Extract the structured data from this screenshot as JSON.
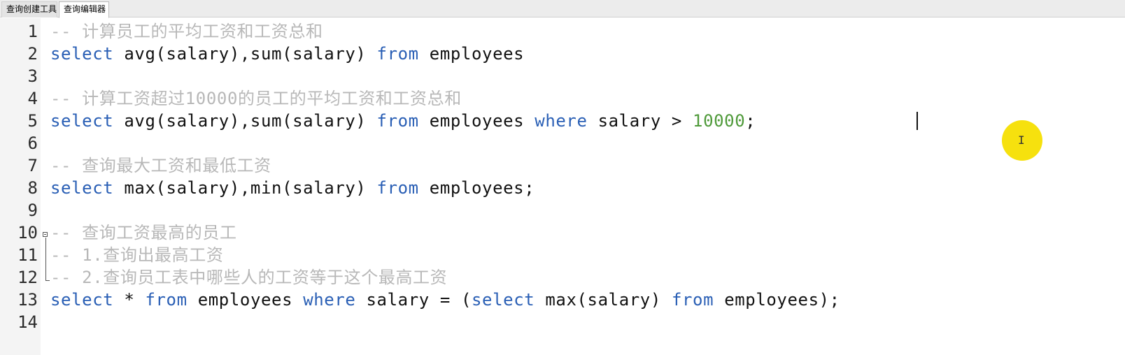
{
  "tabs": [
    {
      "label": "查询创建工具"
    },
    {
      "label": "查询编辑器"
    }
  ],
  "editor": {
    "lines": [
      {
        "num": "1",
        "segments": [
          {
            "type": "comment",
            "text": "-- 计算员工的平均工资和工资总和"
          }
        ]
      },
      {
        "num": "2",
        "segments": [
          {
            "type": "kw",
            "text": "select"
          },
          {
            "type": "plain",
            "text": " avg(salary),sum(salary) "
          },
          {
            "type": "kw",
            "text": "from"
          },
          {
            "type": "plain",
            "text": " employees"
          }
        ]
      },
      {
        "num": "3",
        "segments": []
      },
      {
        "num": "4",
        "segments": [
          {
            "type": "comment",
            "text": "-- 计算工资超过10000的员工的平均工资和工资总和"
          }
        ]
      },
      {
        "num": "5",
        "segments": [
          {
            "type": "kw",
            "text": "select"
          },
          {
            "type": "plain",
            "text": " avg(salary),sum(salary) "
          },
          {
            "type": "kw",
            "text": "from"
          },
          {
            "type": "plain",
            "text": " employees "
          },
          {
            "type": "kw",
            "text": "where"
          },
          {
            "type": "plain",
            "text": " salary > "
          },
          {
            "type": "num",
            "text": "10000"
          },
          {
            "type": "plain",
            "text": ";"
          }
        ]
      },
      {
        "num": "6",
        "segments": []
      },
      {
        "num": "7",
        "segments": [
          {
            "type": "comment",
            "text": "-- 查询最大工资和最低工资"
          }
        ]
      },
      {
        "num": "8",
        "segments": [
          {
            "type": "kw",
            "text": "select"
          },
          {
            "type": "plain",
            "text": " max(salary),min(salary) "
          },
          {
            "type": "kw",
            "text": "from"
          },
          {
            "type": "plain",
            "text": " employees;"
          }
        ]
      },
      {
        "num": "9",
        "segments": []
      },
      {
        "num": "10",
        "segments": [
          {
            "type": "comment",
            "text": "-- 查询工资最高的员工"
          }
        ]
      },
      {
        "num": "11",
        "segments": [
          {
            "type": "comment",
            "text": "-- 1.查询出最高工资"
          }
        ]
      },
      {
        "num": "12",
        "segments": [
          {
            "type": "comment",
            "text": "-- 2.查询员工表中哪些人的工资等于这个最高工资"
          }
        ]
      },
      {
        "num": "13",
        "segments": [
          {
            "type": "kw",
            "text": "select"
          },
          {
            "type": "plain",
            "text": " * "
          },
          {
            "type": "kw",
            "text": "from"
          },
          {
            "type": "plain",
            "text": " employees "
          },
          {
            "type": "kw",
            "text": "where"
          },
          {
            "type": "plain",
            "text": " salary = ("
          },
          {
            "type": "kw",
            "text": "select"
          },
          {
            "type": "plain",
            "text": " max(salary) "
          },
          {
            "type": "kw",
            "text": "from"
          },
          {
            "type": "plain",
            "text": " employees);"
          }
        ]
      },
      {
        "num": "14",
        "segments": []
      }
    ]
  },
  "icons": {
    "fold": "fold-collapse-icon",
    "cursor": "text-cursor-icon"
  },
  "colors": {
    "keyword": "#2a5fb5",
    "comment": "#b8b8b8",
    "number": "#4f9a3a",
    "cursor_highlight": "#f6e10e"
  }
}
